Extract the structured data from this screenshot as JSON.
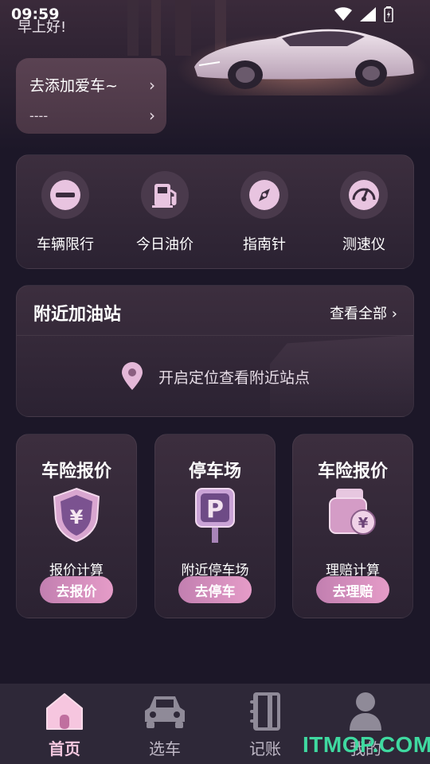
{
  "status_bar": {
    "time": "09:59"
  },
  "header": {
    "greeting": "早上好!",
    "add_car_label": "去添加爱车~",
    "car_placeholder": "----"
  },
  "tools": [
    {
      "label": "车辆限行",
      "icon": "minus-circle-icon"
    },
    {
      "label": "今日油价",
      "icon": "fuel-pump-icon"
    },
    {
      "label": "指南针",
      "icon": "compass-icon"
    },
    {
      "label": "测速仪",
      "icon": "speedometer-icon"
    }
  ],
  "gas_stations": {
    "title": "附近加油站",
    "view_all": "查看全部",
    "empty_text": "开启定位查看附近站点"
  },
  "feature_cards": [
    {
      "title": "车险报价",
      "subtitle": "报价计算",
      "button": "去报价",
      "icon": "shield-yuan-icon"
    },
    {
      "title": "停车场",
      "subtitle": "附近停车场",
      "button": "去停车",
      "icon": "parking-sign-icon"
    },
    {
      "title": "车险报价",
      "subtitle": "理赔计算",
      "button": "去理赔",
      "icon": "wallet-yuan-icon"
    }
  ],
  "bottom_nav": [
    {
      "label": "首页",
      "icon": "home-icon",
      "active": true
    },
    {
      "label": "选车",
      "icon": "car-icon",
      "active": false
    },
    {
      "label": "记账",
      "icon": "notebook-icon",
      "active": false
    },
    {
      "label": "我的",
      "icon": "user-icon",
      "active": false
    }
  ],
  "watermark": "ITMOP.COM",
  "colors": {
    "background": "#1c1728",
    "card": "#2b2232",
    "accent_pink": "#e59cc8",
    "nav_bg": "#2e2838",
    "watermark_green": "#3fd9a0"
  }
}
